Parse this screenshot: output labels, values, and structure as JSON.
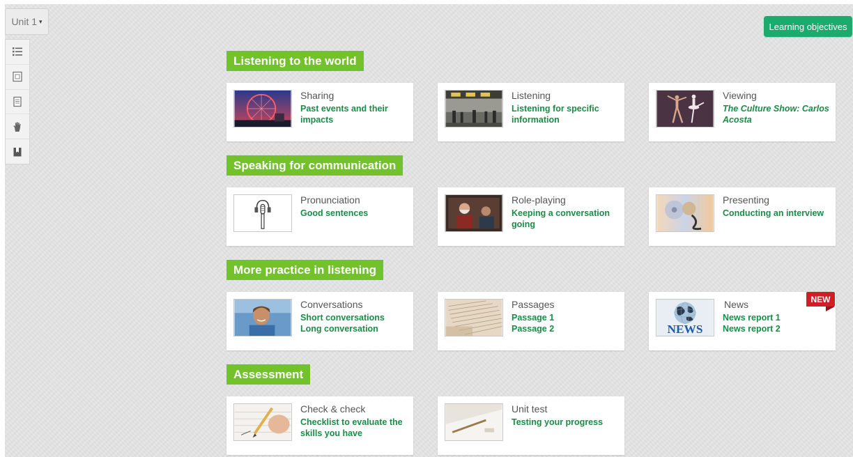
{
  "unit_selector": {
    "label": "Unit 1",
    "caret": "▾"
  },
  "toolbar": {
    "buttons": [
      {
        "icon": "list-icon"
      },
      {
        "icon": "notebook-icon"
      },
      {
        "icon": "document-icon"
      },
      {
        "icon": "hand-icon"
      },
      {
        "icon": "bookmark-icon"
      }
    ]
  },
  "learning_objectives": {
    "label": "Learning objectives"
  },
  "sections": [
    {
      "title": "Listening to the world",
      "cards": [
        {
          "title": "Sharing",
          "links": [
            "Past events and their impacts"
          ],
          "thumb": "london-eye-photo"
        },
        {
          "title": "Listening",
          "links": [
            "Listening for specific information"
          ],
          "thumb": "station-photo"
        },
        {
          "title": "Viewing",
          "links": [
            "The Culture Show: Carlos Acosta"
          ],
          "thumb": "ballet-photo"
        }
      ]
    },
    {
      "title": "Speaking for communication",
      "cards": [
        {
          "title": "Pronunciation",
          "links": [
            "Good sentences"
          ],
          "thumb": "microphone-drawing"
        },
        {
          "title": "Role-playing",
          "links": [
            "Keeping a conversation going"
          ],
          "thumb": "conversation-photo"
        },
        {
          "title": "Presenting",
          "links": [
            "Conducting an interview"
          ],
          "thumb": "film-reel-photo"
        }
      ]
    },
    {
      "title": "More practice in listening",
      "cards": [
        {
          "title": "Conversations",
          "links": [
            "Short conversations",
            "Long conversation"
          ],
          "thumb": "student-photo"
        },
        {
          "title": "Passages",
          "links": [
            "Passage 1",
            "Passage 2"
          ],
          "thumb": "book-page-photo"
        },
        {
          "title": "News",
          "links": [
            "News report 1",
            "News report 2"
          ],
          "thumb": "news-globe-image",
          "badge": "NEW"
        }
      ]
    },
    {
      "title": "Assessment",
      "cards": [
        {
          "title": "Check & check",
          "links": [
            "Checklist to evaluate the skills you have"
          ],
          "thumb": "pencil-form-photo"
        },
        {
          "title": "Unit test",
          "links": [
            "Testing your progress"
          ],
          "thumb": "test-paper-photo"
        }
      ]
    }
  ],
  "colors": {
    "section_green": "#73c12b",
    "link_green": "#1a8c47",
    "button_green": "#1bac6d",
    "badge_red": "#d11e26",
    "background": "#e3e3e3"
  }
}
